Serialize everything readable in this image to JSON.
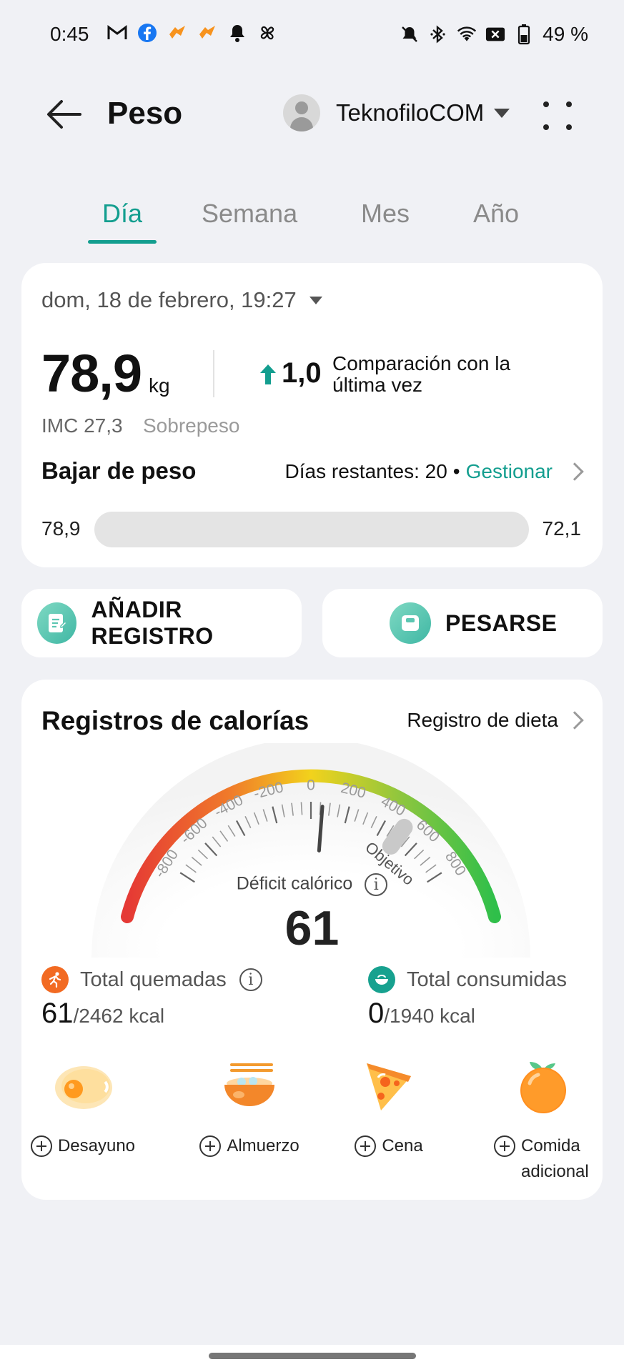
{
  "status_bar": {
    "time": "0:45",
    "battery_text": "49 %",
    "left_icons": [
      "gmail-icon",
      "facebook-icon",
      "heart-rate-icon",
      "heart-rate-icon",
      "notification-bell-icon",
      "pinwheel-icon"
    ],
    "right_icons": [
      "mute-icon",
      "bluetooth-icon",
      "wifi-icon",
      "no-sim-icon",
      "battery-icon"
    ]
  },
  "header": {
    "title": "Peso",
    "user_name": "TeknofiloCOM"
  },
  "tabs": [
    {
      "label": "Día",
      "active": true
    },
    {
      "label": "Semana",
      "active": false
    },
    {
      "label": "Mes",
      "active": false
    },
    {
      "label": "Año",
      "active": false
    }
  ],
  "summary": {
    "date": "dom, 18 de febrero, 19:27",
    "weight": "78,9",
    "unit": "kg",
    "change": "1,0",
    "change_direction": "up",
    "change_label": "Comparación con la última vez",
    "bmi_label": "IMC 27,3",
    "bmi_status": "Sobrepeso",
    "goal_title": "Bajar de peso",
    "days_remaining": "Días restantes: 20",
    "separator": "•",
    "manage": "Gestionar",
    "progress_start": "78,9",
    "progress_target": "72,1",
    "progress_fraction": 0.0
  },
  "actions": {
    "add_record": "AÑADIR REGISTRO",
    "weigh": "PESARSE"
  },
  "calories": {
    "title": "Registros de calorías",
    "diet_link": "Registro de dieta",
    "gauge_ticks": [
      "-800",
      "-600",
      "-400",
      "-200",
      "0",
      "200",
      "400",
      "600",
      "800"
    ],
    "gauge_goal_label": "Objetivo",
    "deficit_label": "Déficit calórico",
    "deficit_value": 61,
    "deficit_value_text": "61",
    "burned_label": "Total quemadas",
    "burned_value": "61",
    "burned_total": "/2462 kcal",
    "consumed_label": "Total consumidas",
    "consumed_value": "0",
    "consumed_total": "/1940 kcal",
    "meals": [
      {
        "label": "Desayuno",
        "icon": "egg-icon"
      },
      {
        "label": "Almuerzo",
        "icon": "bowl-icon"
      },
      {
        "label": "Cena",
        "icon": "pizza-icon"
      },
      {
        "label": "Comida adicional",
        "icon": "orange-icon"
      }
    ]
  },
  "colors": {
    "accent": "#139e8f",
    "background": "#f0f1f5",
    "gauge_red": "#e53935",
    "gauge_yellow": "#f2d21c",
    "gauge_green": "#2fbf4a"
  }
}
